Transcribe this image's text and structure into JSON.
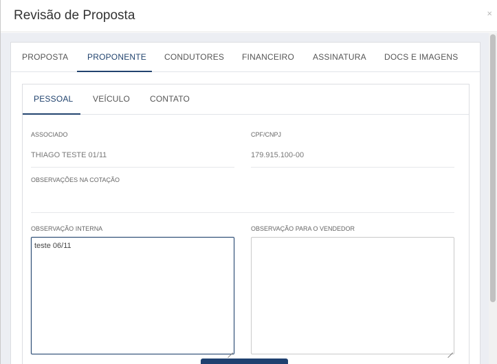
{
  "modal": {
    "title": "Revisão de Proposta",
    "close_label": "×"
  },
  "outer_tabs": [
    {
      "label": "PROPOSTA",
      "active": false
    },
    {
      "label": "PROPONENTE",
      "active": true
    },
    {
      "label": "CONDUTORES",
      "active": false
    },
    {
      "label": "FINANCEIRO",
      "active": false
    },
    {
      "label": "ASSINATURA",
      "active": false
    },
    {
      "label": "DOCS E IMAGENS",
      "active": false
    }
  ],
  "inner_tabs": [
    {
      "label": "PESSOAL",
      "active": true
    },
    {
      "label": "VEÍCULO",
      "active": false
    },
    {
      "label": "CONTATO",
      "active": false
    }
  ],
  "fields": {
    "associado": {
      "label": "ASSOCIADO",
      "value": "THIAGO TESTE 01/11"
    },
    "cpf_cnpj": {
      "label": "CPF/CNPJ",
      "value": "179.915.100-00"
    },
    "observacoes_cotacao": {
      "label": "OBSERVAÇÕES NA COTAÇÃO",
      "value": ""
    },
    "observacao_interna": {
      "label": "OBSERVAÇÃO INTERNA",
      "value": "teste 06/11"
    },
    "observacao_vendedor": {
      "label": "OBSERVAÇÃO PARA O VENDEDOR",
      "value": ""
    }
  },
  "colors": {
    "accent": "#21436e",
    "body_background": "#eceef3",
    "button": "#1f4170"
  }
}
